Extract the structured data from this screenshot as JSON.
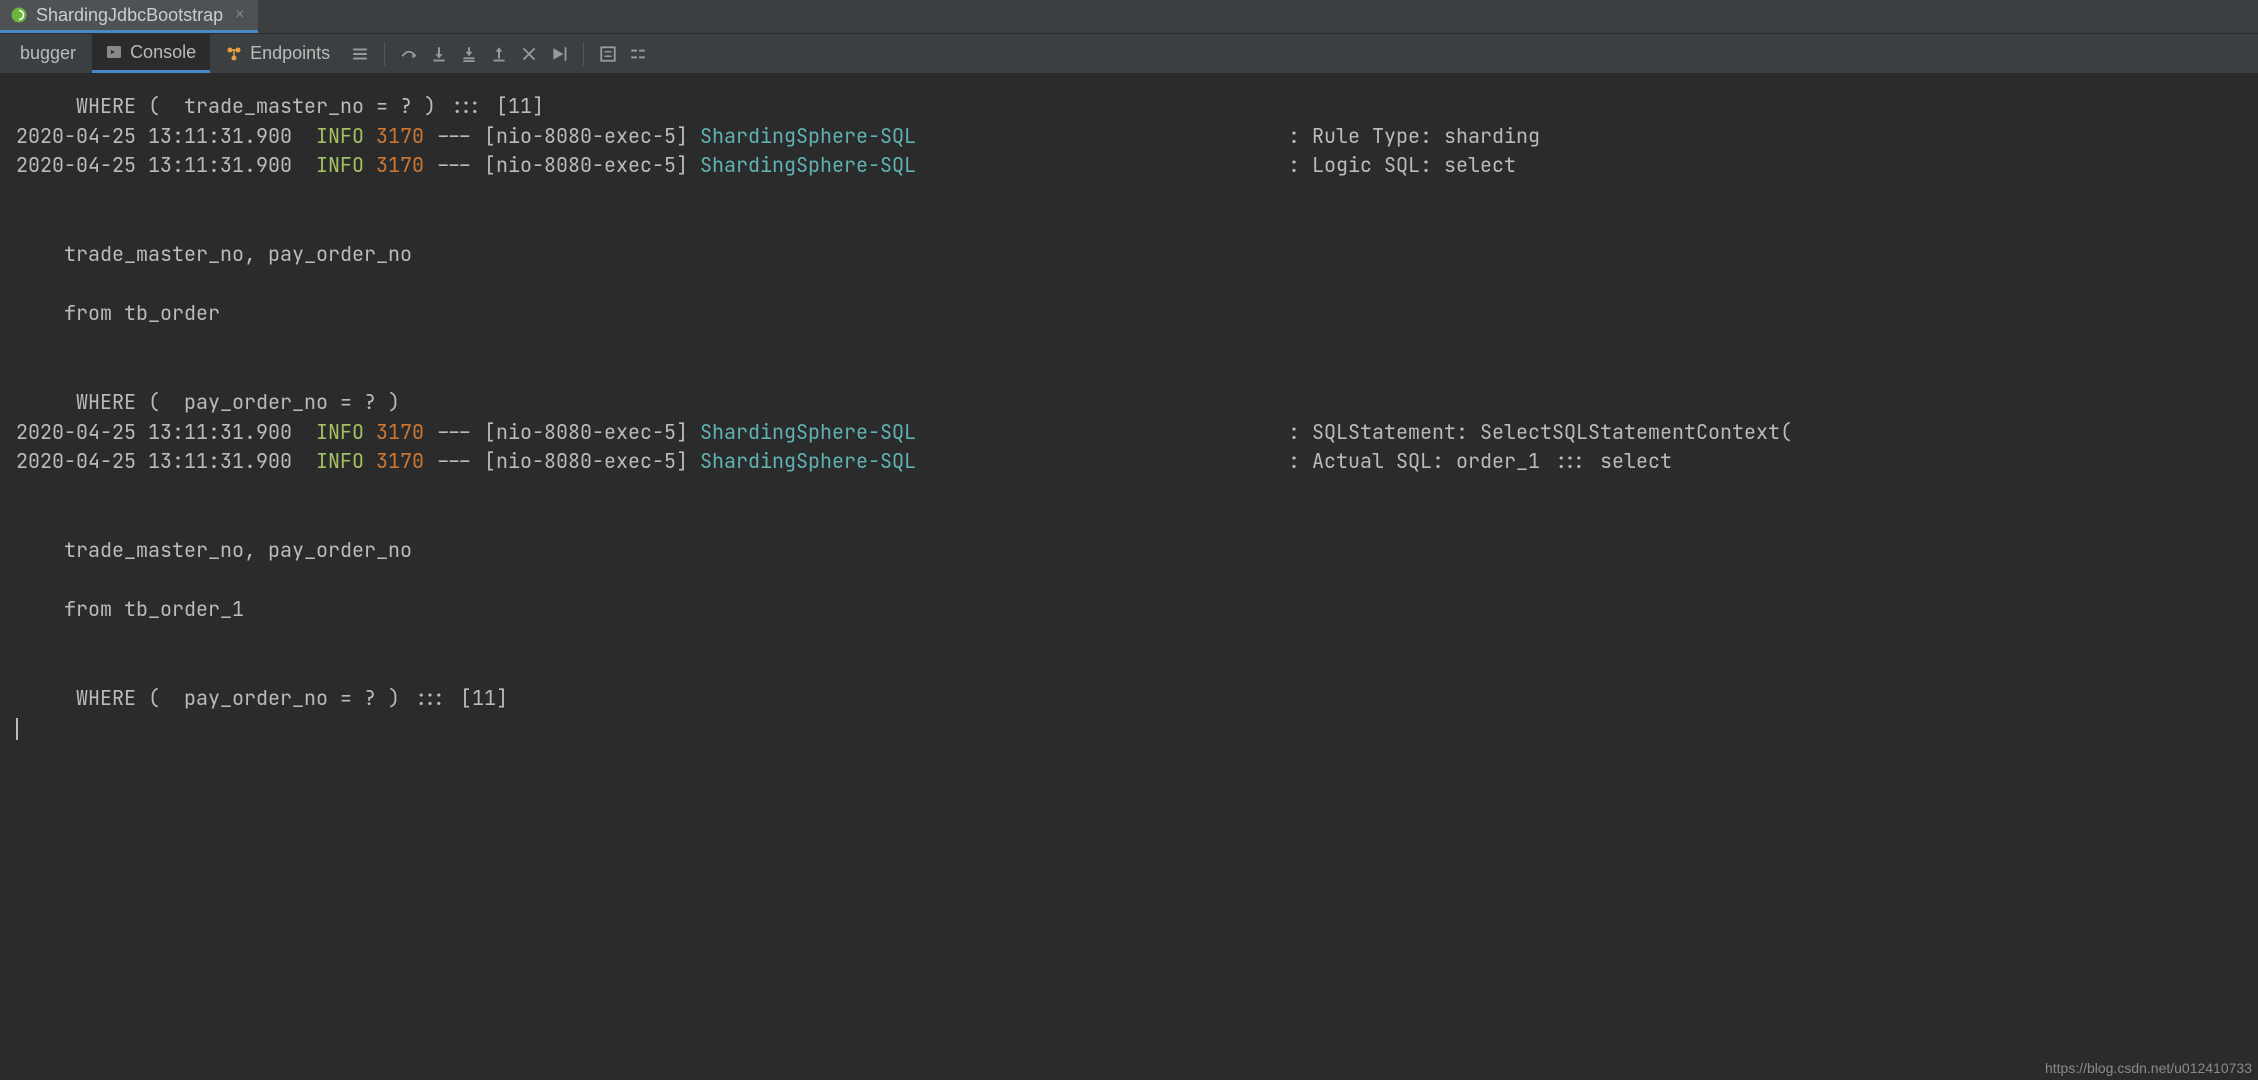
{
  "file_tab": {
    "title": "ShardingJdbcBootstrap"
  },
  "tool_tabs": {
    "debugger": "bugger",
    "console": "Console",
    "endpoints": "Endpoints"
  },
  "colors": {
    "info": "#a5c261",
    "pid": "#cc7832",
    "logger": "#5fb3b3"
  },
  "console": {
    "lines": [
      {
        "type": "plain",
        "text": "     WHERE (  trade_master_no = ? ) ::: [11]"
      },
      {
        "type": "log",
        "timestamp": "2020-04-25 13:11:31.900",
        "level": "INFO",
        "pid": "3170",
        "thread": "[nio-8080-exec-5]",
        "logger": "ShardingSphere-SQL",
        "pad": "                               ",
        "msg": ": Rule Type: sharding"
      },
      {
        "type": "log",
        "timestamp": "2020-04-25 13:11:31.900",
        "level": "INFO",
        "pid": "3170",
        "thread": "[nio-8080-exec-5]",
        "logger": "ShardingSphere-SQL",
        "pad": "                               ",
        "msg": ": Logic SQL: select"
      },
      {
        "type": "blank"
      },
      {
        "type": "blank"
      },
      {
        "type": "plain",
        "text": "    trade_master_no, pay_order_no"
      },
      {
        "type": "blank"
      },
      {
        "type": "plain",
        "text": "    from tb_order"
      },
      {
        "type": "blank"
      },
      {
        "type": "blank"
      },
      {
        "type": "plain",
        "text": "     WHERE (  pay_order_no = ? )"
      },
      {
        "type": "log",
        "timestamp": "2020-04-25 13:11:31.900",
        "level": "INFO",
        "pid": "3170",
        "thread": "[nio-8080-exec-5]",
        "logger": "ShardingSphere-SQL",
        "pad": "                               ",
        "msg": ": SQLStatement: SelectSQLStatementContext("
      },
      {
        "type": "log",
        "timestamp": "2020-04-25 13:11:31.900",
        "level": "INFO",
        "pid": "3170",
        "thread": "[nio-8080-exec-5]",
        "logger": "ShardingSphere-SQL",
        "pad": "                               ",
        "msg": ": Actual SQL: order_1 ::: select"
      },
      {
        "type": "blank"
      },
      {
        "type": "blank"
      },
      {
        "type": "plain",
        "text": "    trade_master_no, pay_order_no"
      },
      {
        "type": "blank"
      },
      {
        "type": "plain",
        "text": "    from tb_order_1"
      },
      {
        "type": "blank"
      },
      {
        "type": "blank"
      },
      {
        "type": "plain",
        "text": "     WHERE (  pay_order_no = ? ) ::: [11]"
      }
    ]
  },
  "watermark": "https://blog.csdn.net/u012410733"
}
